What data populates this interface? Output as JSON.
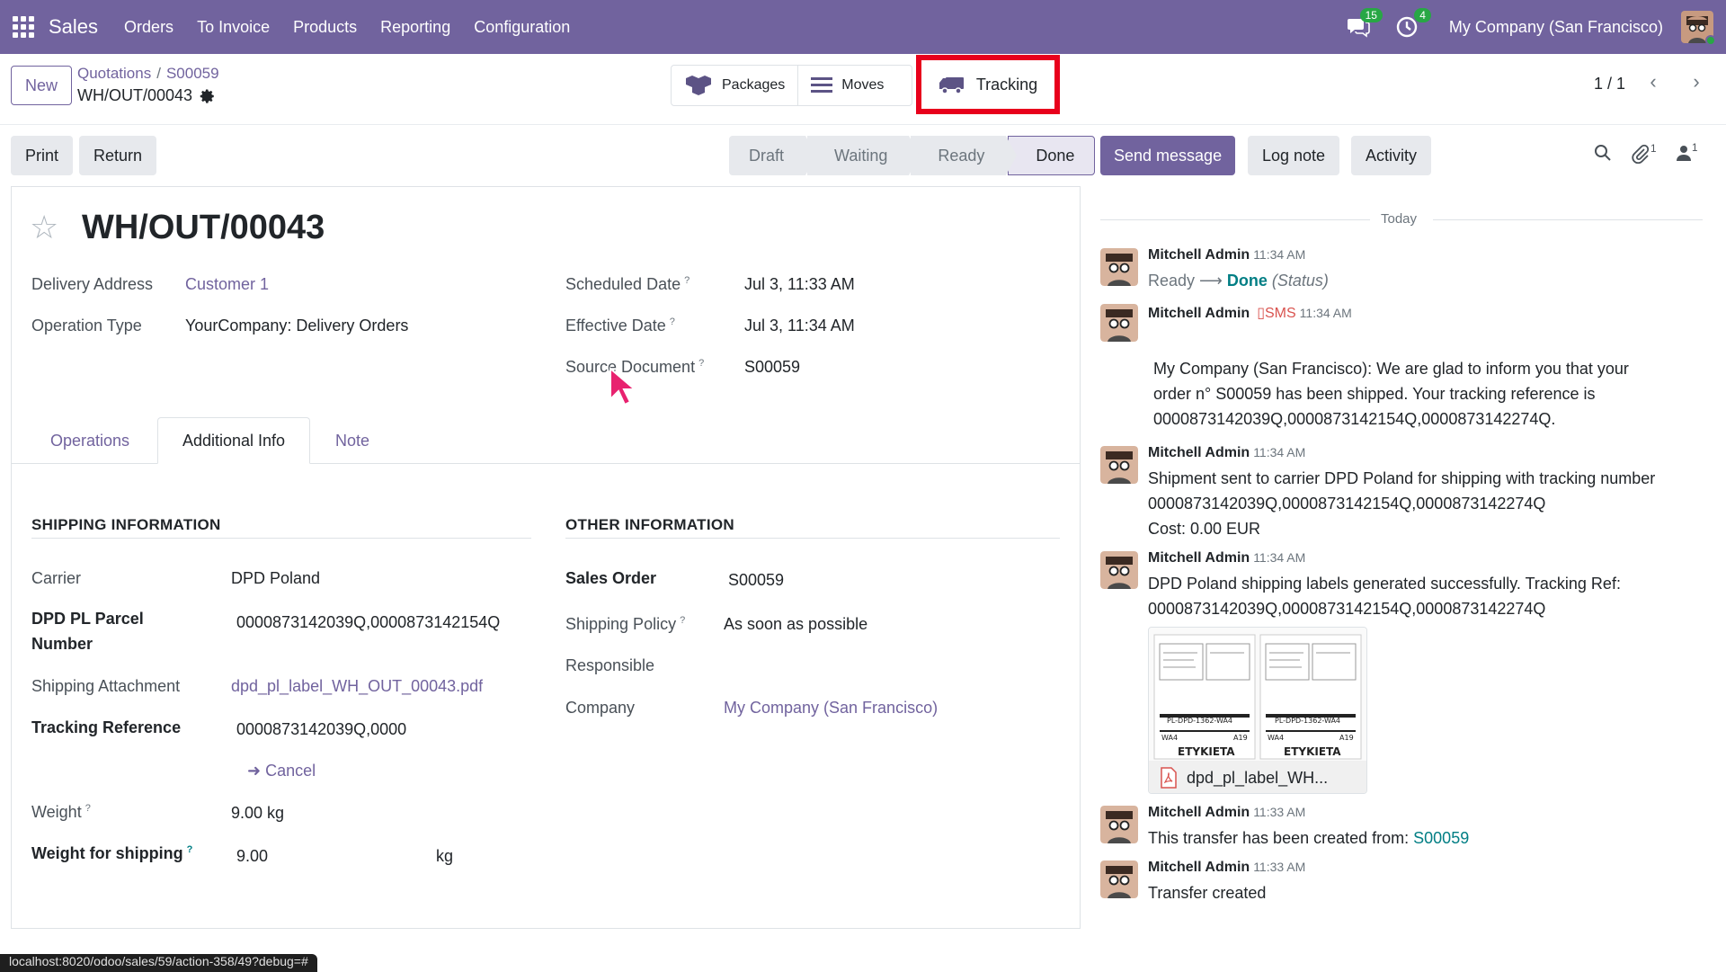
{
  "navbar": {
    "brand": "Sales",
    "menu": [
      "Orders",
      "To Invoice",
      "Products",
      "Reporting",
      "Configuration"
    ],
    "messages_count": "15",
    "activities_count": "4",
    "company": "My Company (San Francisco)"
  },
  "control": {
    "new_label": "New",
    "breadcrumb": [
      "Quotations",
      "S00059"
    ],
    "record_name": "WH/OUT/00043",
    "smart_buttons": [
      "Packages",
      "Moves"
    ],
    "tracking_label": "Tracking",
    "pager": "1 / 1"
  },
  "actions": {
    "print": "Print",
    "return": "Return",
    "statuses": [
      "Draft",
      "Waiting",
      "Ready",
      "Done"
    ],
    "current_status": "Done",
    "send_message": "Send message",
    "log_note": "Log note",
    "activity": "Activity",
    "attachments_count": "1",
    "followers_count": "1"
  },
  "form": {
    "title": "WH/OUT/00043",
    "delivery_address_label": "Delivery Address",
    "delivery_address": "Customer 1",
    "operation_type_label": "Operation Type",
    "operation_type": "YourCompany: Delivery Orders",
    "scheduled_date_label": "Scheduled Date",
    "scheduled_date": "Jul 3, 11:33 AM",
    "effective_date_label": "Effective Date",
    "effective_date": "Jul 3, 11:34 AM",
    "source_document_label": "Source Document",
    "source_document": "S00059",
    "tabs": [
      "Operations",
      "Additional Info",
      "Note"
    ],
    "shipping": {
      "title": "SHIPPING INFORMATION",
      "carrier_label": "Carrier",
      "carrier": "DPD Poland",
      "parcel_label_1": "DPD PL Parcel",
      "parcel_label_2": "Number",
      "parcel": "0000873142039Q,0000873142154Q",
      "attachment_label": "Shipping Attachment",
      "attachment": "dpd_pl_label_WH_OUT_00043.pdf",
      "tracking_label": "Tracking Reference",
      "tracking": "0000873142039Q,0000",
      "cancel": "Cancel",
      "weight_label": "Weight",
      "weight": "9.00 kg",
      "weight_shipping_label": "Weight for shipping",
      "weight_shipping": "9.00",
      "weight_unit": "kg"
    },
    "other": {
      "title": "OTHER INFORMATION",
      "sales_order_label": "Sales Order",
      "sales_order": "S00059",
      "policy_label": "Shipping Policy",
      "policy": "As soon as possible",
      "responsible_label": "Responsible",
      "company_label": "Company",
      "company": "My Company (San Francisco)"
    }
  },
  "chatter": {
    "today": "Today",
    "messages": [
      {
        "author": "Mitchell Admin",
        "time": "11:34 AM",
        "from": "Ready",
        "to": "Done",
        "field": "(Status)"
      },
      {
        "author": "Mitchell Admin",
        "sms": "SMS",
        "time": "11:34 AM",
        "lines": [
          "My Company (San Francisco): We are glad to inform you that your",
          "order n° S00059 has been shipped. Your tracking reference is",
          "0000873142039Q,0000873142154Q,0000873142274Q."
        ]
      },
      {
        "author": "Mitchell Admin",
        "time": "11:34 AM",
        "lines": [
          "Shipment sent to carrier DPD Poland for shipping with tracking number",
          "0000873142039Q,0000873142154Q,0000873142274Q",
          "Cost: 0.00 EUR"
        ]
      },
      {
        "author": "Mitchell Admin",
        "time": "11:34 AM",
        "lines": [
          "DPD Poland shipping labels generated successfully. Tracking Ref:",
          "0000873142039Q,0000873142154Q,0000873142274Q"
        ],
        "attachment": "dpd_pl_label_WH..."
      },
      {
        "author": "Mitchell Admin",
        "time": "11:33 AM",
        "text": "This transfer has been created from:",
        "link": "S00059"
      },
      {
        "author": "Mitchell Admin",
        "time": "11:33 AM",
        "text": "Transfer created"
      }
    ],
    "label_texts": [
      "PL-DPD-1362-WA4",
      "ETYKIETA",
      "WA4",
      "A19"
    ]
  },
  "browser_status_url": "localhost:8020/odoo/sales/59/action-358/49?debug=#",
  "colors": {
    "brand": "#71639e",
    "highlight": "#e8001c",
    "link": "#017e84"
  }
}
